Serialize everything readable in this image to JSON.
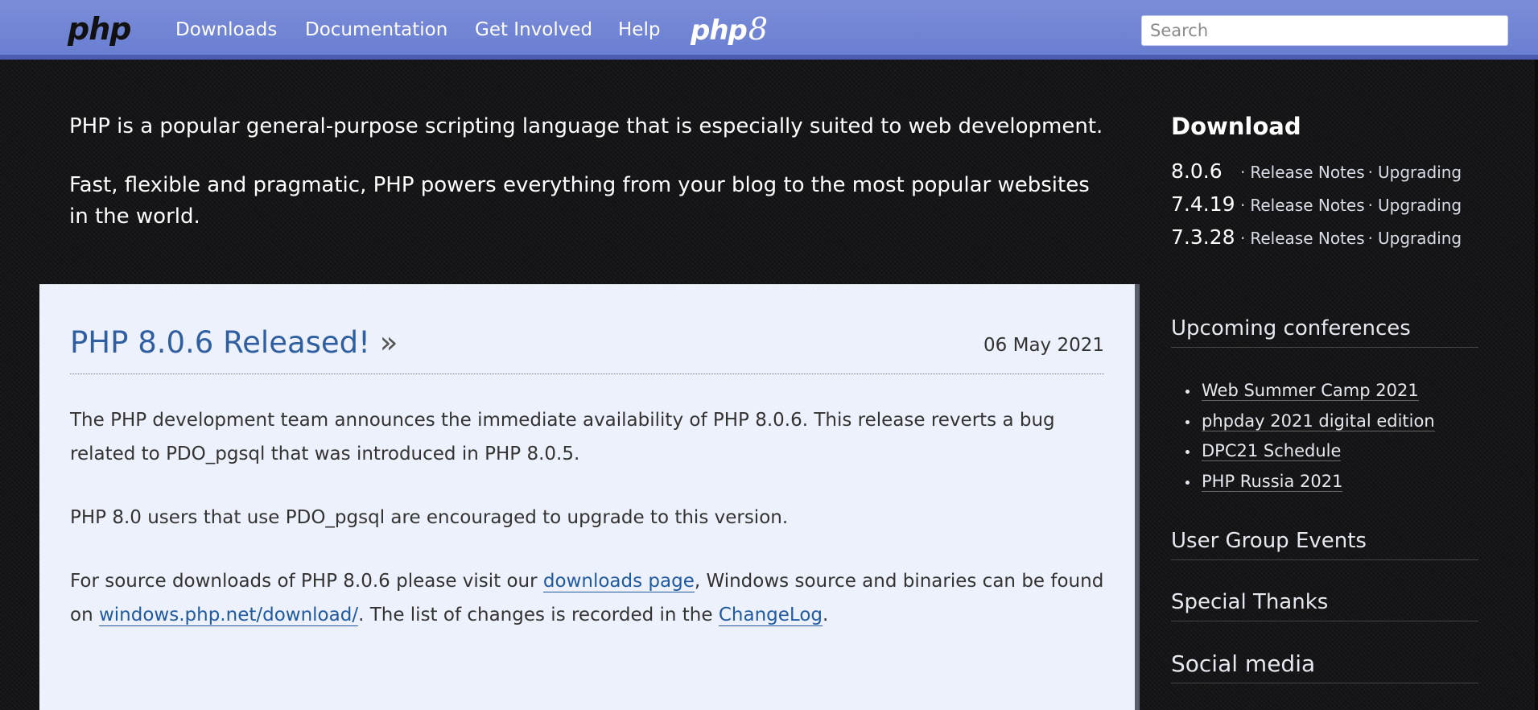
{
  "nav": {
    "brand": "php",
    "links": [
      "Downloads",
      "Documentation",
      "Get Involved",
      "Help"
    ],
    "php8_logo_text": "php",
    "php8_logo_digit": "8",
    "search_placeholder": "Search"
  },
  "intro": {
    "line1": "PHP is a popular general-purpose scripting language that is especially suited to web development.",
    "line2": "Fast, flexible and pragmatic, PHP powers everything from your blog to the most popular websites in the world."
  },
  "news": {
    "title": "PHP 8.0.6 Released!",
    "title_suffix": "»",
    "date": "06 May 2021",
    "p1": "The PHP development team announces the immediate availability of PHP 8.0.6. This release reverts a bug related to PDO_pgsql that was introduced in PHP 8.0.5.",
    "p2": "PHP 8.0 users that use PDO_pgsql are encouraged to upgrade to this version.",
    "p3_part1": "For source downloads of PHP 8.0.6 please visit our ",
    "p3_link1": "downloads page",
    "p3_part2": ", Windows source and binaries can be found on ",
    "p3_link2": "windows.php.net/download/",
    "p3_part3": ". The list of changes is recorded in the ",
    "p3_link3": "ChangeLog",
    "p3_part4": "."
  },
  "sidebar": {
    "download_heading": "Download",
    "downloads": [
      {
        "version": "8.0.6",
        "notes": "Release Notes",
        "upgrading": "Upgrading"
      },
      {
        "version": "7.4.19",
        "notes": "Release Notes",
        "upgrading": "Upgrading"
      },
      {
        "version": "7.3.28",
        "notes": "Release Notes",
        "upgrading": "Upgrading"
      }
    ],
    "separator": "·",
    "conferences_heading": "Upcoming conferences",
    "conferences": [
      "Web Summer Camp 2021",
      "phpday 2021 digital edition",
      "DPC21 Schedule",
      "PHP Russia 2021"
    ],
    "user_group_events": "User Group Events",
    "special_thanks": "Special Thanks",
    "social_media": "Social media"
  },
  "colors": {
    "nav_bg": "#7b8dd8",
    "nav_border": "#4b5cb1",
    "page_bg": "#151517",
    "card_bg": "#edf1fb",
    "link_blue": "#2f5fa0"
  }
}
